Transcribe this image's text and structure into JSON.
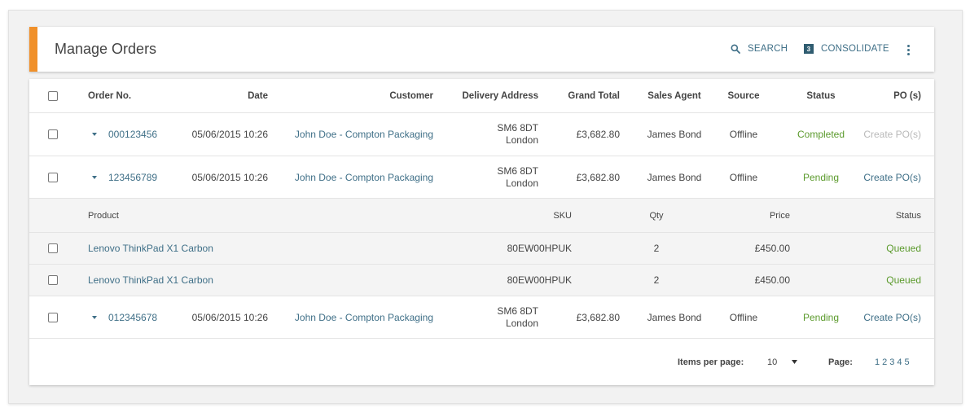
{
  "header": {
    "title": "Manage Orders",
    "search_label": "SEARCH",
    "consolidate_label": "CONSOLIDATE",
    "consolidate_count": "3"
  },
  "table": {
    "columns": {
      "order_no": "Order No.",
      "date": "Date",
      "customer": "Customer",
      "delivery_address": "Delivery Address",
      "grand_total": "Grand Total",
      "sales_agent": "Sales Agent",
      "source": "Source",
      "status": "Status",
      "po": "PO (s)"
    },
    "orders": [
      {
        "order_no": "000123456",
        "date": "05/06/2015 10:26",
        "customer": "John Doe - Compton Packaging",
        "address_line1": "SM6 8DT",
        "address_line2": "London",
        "grand_total": "£3,682.80",
        "sales_agent": "James Bond",
        "source": "Offline",
        "status": "Completed",
        "po": "Create PO(s)"
      },
      {
        "order_no": "123456789",
        "date": "05/06/2015 10:26",
        "customer": "John Doe - Compton Packaging",
        "address_line1": "SM6 8DT",
        "address_line2": "London",
        "grand_total": "£3,682.80",
        "sales_agent": "James Bond",
        "source": "Offline",
        "status": "Pending",
        "po": "Create PO(s)"
      },
      {
        "order_no": "012345678",
        "date": "05/06/2015 10:26",
        "customer": "John Doe - Compton Packaging",
        "address_line1": "SM6 8DT",
        "address_line2": "London",
        "grand_total": "£3,682.80",
        "sales_agent": "James Bond",
        "source": "Offline",
        "status": "Pending",
        "po": "Create PO(s)"
      }
    ],
    "sub_columns": {
      "product": "Product",
      "sku": "SKU",
      "qty": "Qty",
      "price": "Price",
      "status": "Status"
    },
    "sub_items": [
      {
        "product": "Lenovo ThinkPad X1 Carbon",
        "sku": "80EW00HPUK",
        "qty": "2",
        "price": "£450.00",
        "status": "Queued"
      },
      {
        "product": "Lenovo ThinkPad X1 Carbon",
        "sku": "80EW00HPUK",
        "qty": "2",
        "price": "£450.00",
        "status": "Queued"
      }
    ]
  },
  "footer": {
    "items_per_page_label": "Items per page:",
    "items_per_page_value": "10",
    "page_label": "Page:",
    "pages": [
      "1",
      "2",
      "3",
      "4",
      "5"
    ]
  },
  "colors": {
    "accent": "#f0902a",
    "link": "#3f6f87",
    "status_green": "#5b9a2c",
    "disabled": "#b9b9b9"
  },
  "icons": [
    "search-icon",
    "kebab-menu-icon",
    "chevron-down-icon",
    "dropdown-arrow-icon"
  ]
}
